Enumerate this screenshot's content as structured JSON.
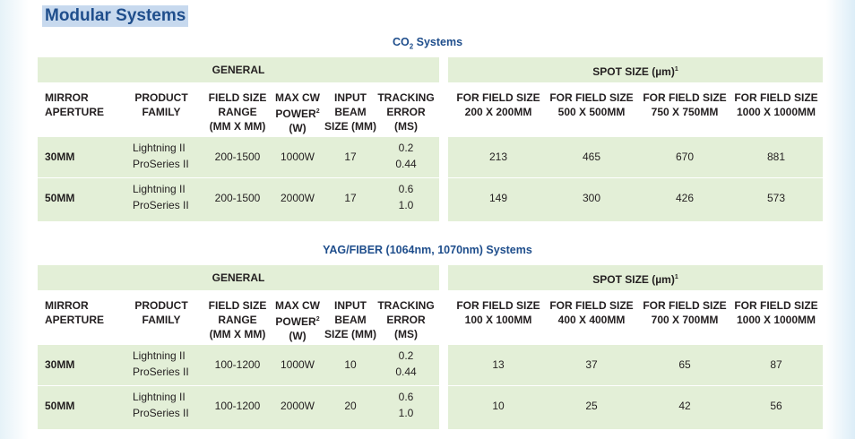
{
  "page": {
    "title": "Modular Systems"
  },
  "tables": [
    {
      "caption_main": "CO",
      "caption_sub": "2",
      "caption_rest": " Systems",
      "general_label": "GENERAL",
      "spot_label": "SPOT SIZE (µm)",
      "spot_sup": "1",
      "columns": {
        "mirror": [
          "MIRROR",
          "APERTURE"
        ],
        "product": [
          "PRODUCT",
          "FAMILY"
        ],
        "field": [
          "FIELD SIZE",
          "RANGE",
          "(MM X MM)"
        ],
        "maxcw": [
          "MAX CW",
          "POWER",
          "(W)"
        ],
        "maxcw_sup": "2",
        "input": [
          "INPUT",
          "BEAM",
          "SIZE (MM)"
        ],
        "tracking": [
          "TRACKING",
          "ERROR",
          "(MS)"
        ],
        "spot": [
          [
            "FOR FIELD SIZE",
            "200 X 200MM"
          ],
          [
            "FOR FIELD SIZE",
            "500 X 500MM"
          ],
          [
            "FOR FIELD SIZE",
            "750 X 750MM"
          ],
          [
            "FOR FIELD SIZE",
            "1000 X 1000MM"
          ]
        ]
      },
      "rows": [
        {
          "mirror": "30MM",
          "products": [
            "Lightning II",
            "ProSeries II"
          ],
          "field": "200-1500",
          "maxcw": "1000W",
          "input": "17",
          "tracking": [
            "0.2",
            "0.44"
          ],
          "spots": [
            "213",
            "465",
            "670",
            "881"
          ]
        },
        {
          "mirror": "50MM",
          "products": [
            "Lightning II",
            "ProSeries II"
          ],
          "field": "200-1500",
          "maxcw": "2000W",
          "input": "17",
          "tracking": [
            "0.6",
            "1.0"
          ],
          "spots": [
            "149",
            "300",
            "426",
            "573"
          ]
        }
      ]
    },
    {
      "caption_main": "YAG/FIBER (1064nm, 1070nm) Systems",
      "caption_sub": "",
      "caption_rest": "",
      "general_label": "GENERAL",
      "spot_label": "SPOT SIZE (µm)",
      "spot_sup": "1",
      "columns": {
        "mirror": [
          "MIRROR",
          "APERTURE"
        ],
        "product": [
          "PRODUCT",
          "FAMILY"
        ],
        "field": [
          "FIELD SIZE",
          "RANGE",
          "(MM X MM)"
        ],
        "maxcw": [
          "MAX CW",
          "POWER",
          "(W)"
        ],
        "maxcw_sup": "2",
        "input": [
          "INPUT",
          "BEAM",
          "SIZE (MM)"
        ],
        "tracking": [
          "TRACKING",
          "ERROR",
          "(MS)"
        ],
        "spot": [
          [
            "FOR FIELD SIZE",
            "100 X 100MM"
          ],
          [
            "FOR FIELD SIZE",
            "400 X 400MM"
          ],
          [
            "FOR FIELD SIZE",
            "700 X 700MM"
          ],
          [
            "FOR FIELD SIZE",
            "1000 X 1000MM"
          ]
        ]
      },
      "rows": [
        {
          "mirror": "30MM",
          "products": [
            "Lightning II",
            "ProSeries II"
          ],
          "field": "100-1200",
          "maxcw": "1000W",
          "input": "10",
          "tracking": [
            "0.2",
            "0.44"
          ],
          "spots": [
            "13",
            "37",
            "65",
            "87"
          ]
        },
        {
          "mirror": "50MM",
          "products": [
            "Lightning II",
            "ProSeries II"
          ],
          "field": "100-1200",
          "maxcw": "2000W",
          "input": "20",
          "tracking": [
            "0.6",
            "1.0"
          ],
          "spots": [
            "10",
            "25",
            "42",
            "56"
          ]
        }
      ]
    }
  ]
}
